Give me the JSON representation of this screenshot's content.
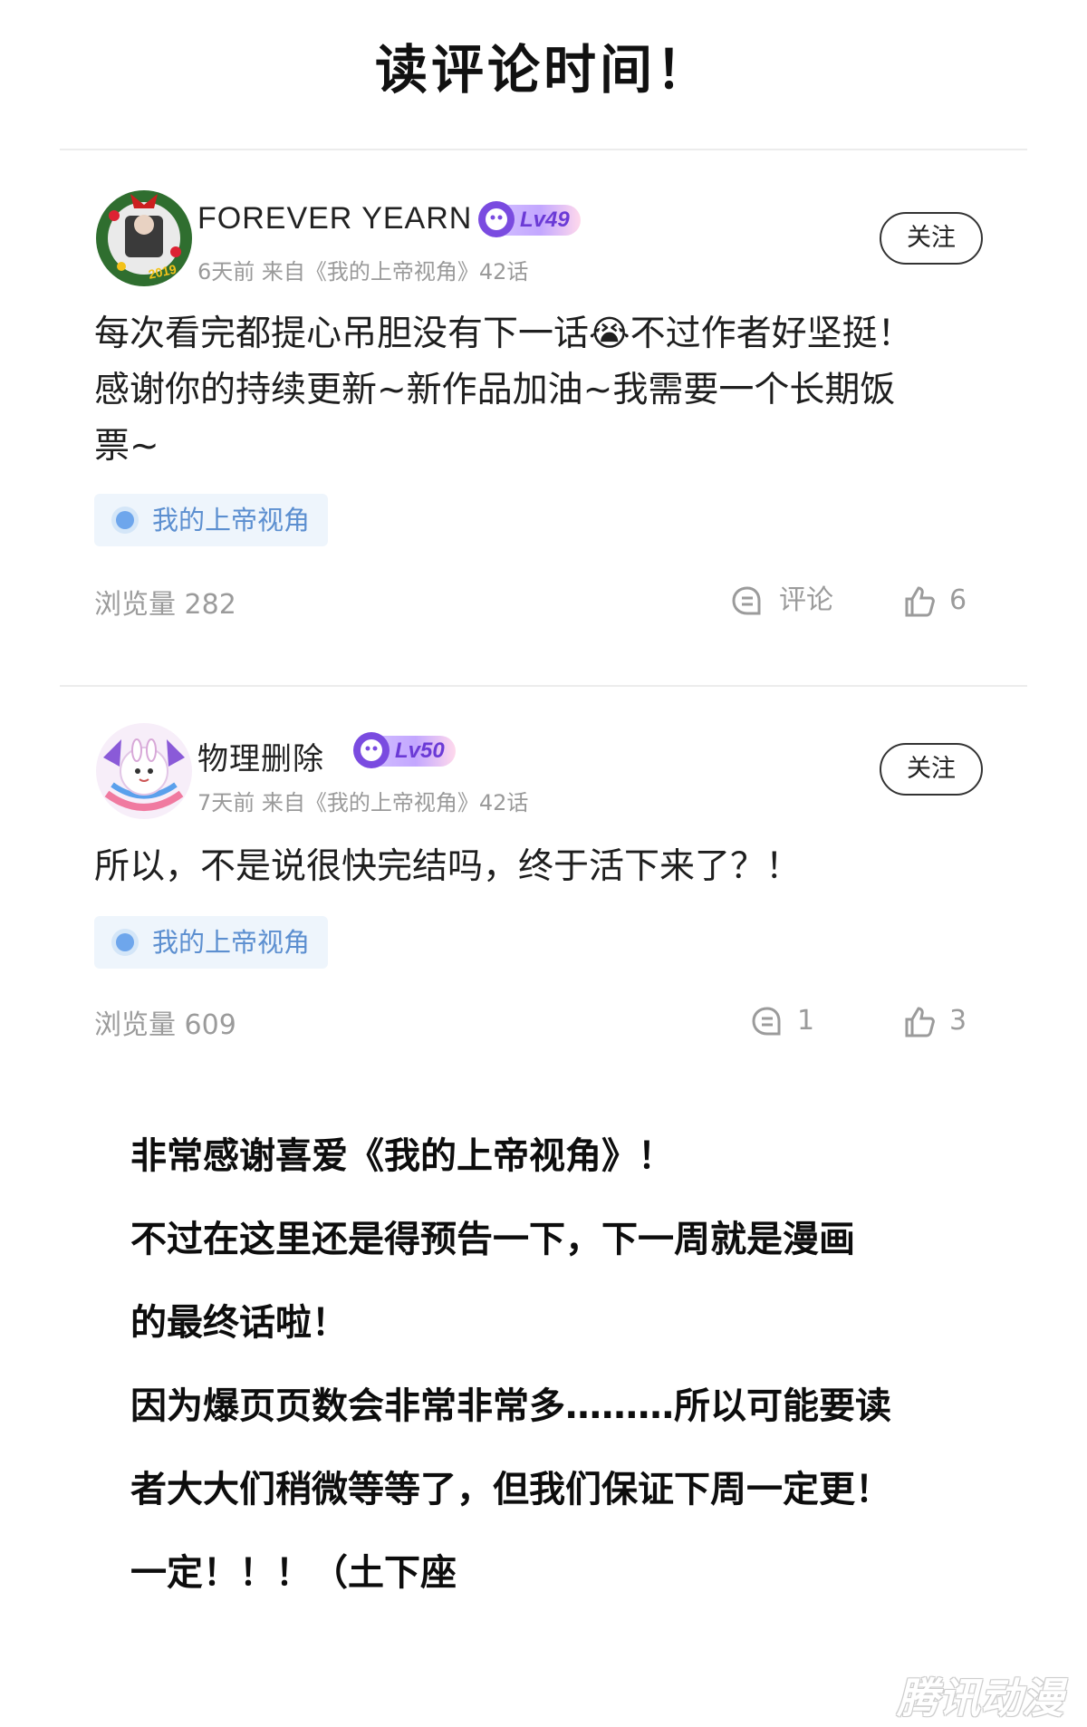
{
  "page_title": "读评论时间！",
  "comments": [
    {
      "username": "FOREVER YEARN",
      "level": "Lv49",
      "meta": "6天前 来自《我的上帝视角》42话",
      "avatar_text": "2019",
      "follow_label": "关注",
      "text_lines": [
        "每次看完都提心吊胆没有下一话😭不过作者好坚挺！",
        "感谢你的持续更新~新作品加油~我需要一个长期饭",
        "票~"
      ],
      "tag": "我的上帝视角",
      "views": "浏览量 282",
      "comment_label": "评论",
      "likes": "6"
    },
    {
      "username": "物理删除",
      "level": "Lv50",
      "meta": "7天前 来自《我的上帝视角》42话",
      "follow_label": "关注",
      "text_lines": [
        "所以，不是说很快完结吗，终于活下来了？！"
      ],
      "tag": "我的上帝视角",
      "views": "浏览量 609",
      "comment_label": "1",
      "likes": "3"
    }
  ],
  "announcement": [
    "非常感谢喜爱《我的上帝视角》！",
    "不过在这里还是得预告一下，下一周就是漫画",
    "的最终话啦！",
    "因为爆页页数会非常非常多………所以可能要读",
    "者大大们稍微等等了，但我们保证下周一定更！",
    "一定！！！（土下座"
  ],
  "watermark": "腾讯动漫",
  "colors": {
    "tag_bg": "#eef5fc",
    "tag_text": "#5c8fd0",
    "muted": "#9b9b9b",
    "level_text": "#6b3ad6"
  },
  "icons": [
    "wreath-avatar",
    "bunny-avatar",
    "level-badge-icon",
    "comment-icon",
    "thumbs-up-icon"
  ]
}
